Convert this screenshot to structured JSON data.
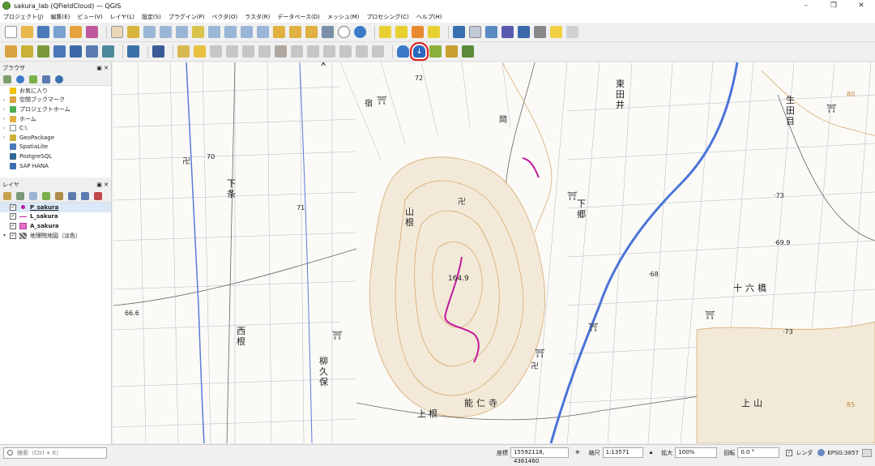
{
  "window": {
    "title": "sakura_lab (QFieldCloud) — QGIS",
    "controls": [
      "–",
      "❐",
      "✕"
    ]
  },
  "menu": [
    "プロジェクト(J)",
    "編集(E)",
    "ビュー(V)",
    "レイヤ(L)",
    "設定(S)",
    "プラグイン(P)",
    "ベクタ(O)",
    "ラスタ(R)",
    "データベース(D)",
    "メッシュ(M)",
    "プロセシング(C)",
    "ヘルプ(H)"
  ],
  "toolbar1_icons": [
    "new-project",
    "open-project",
    "save-project",
    "save-as",
    "print-layout",
    "style-manager",
    "pan",
    "pan-to-selection",
    "zoom-in",
    "zoom-out",
    "zoom-full",
    "zoom-to-selection",
    "zoom-to-layer",
    "zoom-to-native",
    "zoom-last",
    "zoom-next",
    "new-map-view",
    "new-3d-view",
    "new-bookmark",
    "show-bookmarks",
    "temporal-controller",
    "refresh",
    "select-features",
    "select-by-expression",
    "deselect",
    "select-by-location",
    "identify",
    "attribute-table",
    "processing-toolbox",
    "statistics",
    "measure",
    "map-tips",
    "locator"
  ],
  "toolbar2_icons": [
    "open-data-source-manager",
    "new-geopackage",
    "add-vector",
    "add-raster",
    "add-mesh",
    "add-wms",
    "add-wfs",
    "python-console",
    "help",
    "current-edits",
    "toggle-editing",
    "save-edits",
    "digitize",
    "node-tool",
    "delete-selected",
    "cut",
    "copy",
    "paste",
    "undo",
    "redo",
    "qfieldcloud-icon",
    "qfieldcloud-sync-icon",
    "qfieldsync-package",
    "qfieldsync-sync",
    "qfieldsync-config"
  ],
  "browser": {
    "title": "ブラウザ",
    "items": [
      {
        "label": "お気に入り",
        "icon": "star-icon",
        "color": "#f2c200"
      },
      {
        "label": "空間ブックマーク",
        "icon": "bookmark-icon",
        "color": "#d9a441"
      },
      {
        "label": "プロジェクトホーム",
        "icon": "project-home-icon",
        "color": "#4caf50"
      },
      {
        "label": "ホーム",
        "icon": "home-folder-icon",
        "color": "#e0b040"
      },
      {
        "label": "C:\\",
        "icon": "drive-icon",
        "color": "#888888"
      },
      {
        "label": "GeoPackage",
        "icon": "geopackage-icon",
        "color": "#c9b036"
      },
      {
        "label": "SpatiaLite",
        "icon": "spatialite-icon",
        "color": "#4a7bb7"
      },
      {
        "label": "PostgreSQL",
        "icon": "postgresql-icon",
        "color": "#336791"
      },
      {
        "label": "SAP HANA",
        "icon": "sap-hana-icon",
        "color": "#3a6fb0"
      }
    ]
  },
  "layers": {
    "title": "レイヤ",
    "items": [
      {
        "label": "P_sakura",
        "symbol": "point",
        "color": "#c2189e",
        "checked": "✓"
      },
      {
        "label": "L_sakura",
        "symbol": "line",
        "color": "#c2189e",
        "checked": "✓"
      },
      {
        "label": "A_sakura",
        "symbol": "polygon",
        "color": "#e66fc8",
        "checked": "✓"
      },
      {
        "label": "地理院地図（淡色）",
        "symbol": "raster",
        "color": "#666666",
        "checked": "✓"
      }
    ]
  },
  "map": {
    "place_labels": [
      "東",
      "田",
      "井",
      "生",
      "田",
      "目",
      "山",
      "根",
      "下",
      "条",
      "下",
      "郷",
      "西",
      "根",
      "柳",
      "久",
      "保",
      "能",
      "仁",
      "寺",
      "上",
      "根",
      "十",
      "六",
      "橋",
      "上",
      "山",
      "岡",
      "宿"
    ],
    "elevations": [
      "72",
      "70",
      "71",
      "·73",
      "·69.9",
      "·68",
      "164.9",
      "·73",
      "66.6",
      "80",
      "85"
    ]
  },
  "status": {
    "search_placeholder": "検索（Ctrl + K）",
    "coord_label": "座標",
    "coord_value": "15592118, 4361460",
    "scale_label": "縮尺",
    "scale_value": "1:13571",
    "magnifier_label": "拡大",
    "magnifier_value": "100%",
    "rotation_label": "回転",
    "rotation_value": "0.0 °",
    "render_label": "レンダ",
    "crs": "EPSG:3857"
  }
}
